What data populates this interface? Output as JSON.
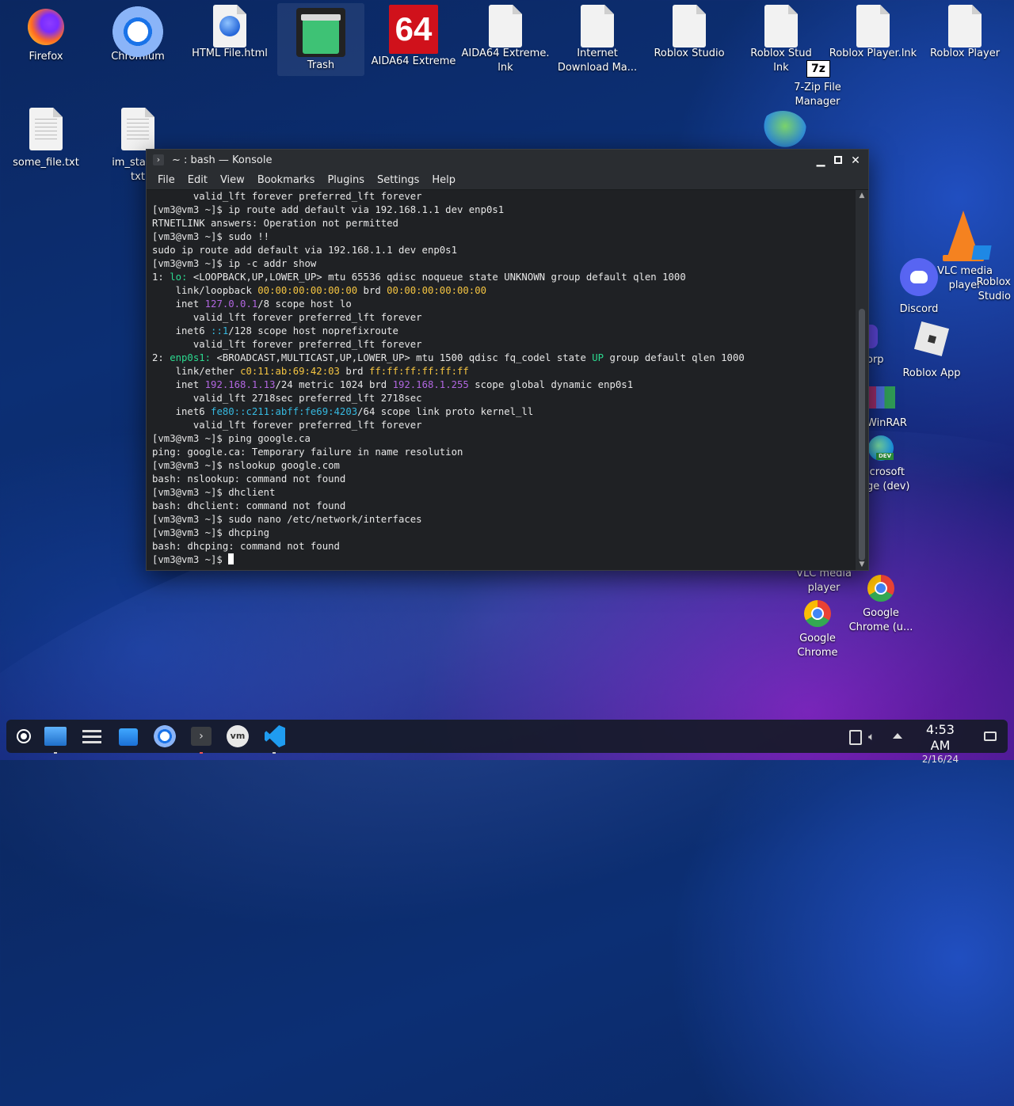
{
  "desktop": {
    "icons": [
      {
        "name": "firefox-icon",
        "label": "Firefox"
      },
      {
        "name": "chromium-icon",
        "label": "Chromium"
      },
      {
        "name": "html-file-icon",
        "label": "HTML File.html"
      },
      {
        "name": "trash-icon",
        "label": "Trash"
      },
      {
        "name": "aida64-icon",
        "label": "AIDA64 Extreme",
        "glyph": "64"
      },
      {
        "name": "aida64-lnk-icon",
        "label": "AIDA64 Extreme.\nlnk"
      },
      {
        "name": "internet-download-manager-icon",
        "label": "Internet\nDownload Ma..."
      },
      {
        "name": "roblox-studio-file-icon",
        "label": "Roblox Studio"
      },
      {
        "name": "roblox-studio-lnk-icon",
        "label": "Roblox Stud\nlnk"
      },
      {
        "name": "roblox-player-lnk-icon",
        "label": "Roblox Player.lnk"
      },
      {
        "name": "roblox-player-file-icon",
        "label": "Roblox Player"
      },
      {
        "name": "seven-zip-icon",
        "label": "7-Zip File\nManager",
        "glyph": "7z"
      },
      {
        "name": "some-file-icon",
        "label": "some_file.txt"
      },
      {
        "name": "im-stalkin-file-icon",
        "label": "im_stalkin\ntxt"
      },
      {
        "name": "vlc-icon",
        "label": "VLC media\nplayer"
      },
      {
        "name": "roblox-studio-icon",
        "label": "Roblox\nStudio"
      },
      {
        "name": "discord-icon",
        "label": "Discord"
      },
      {
        "name": "orp-icon",
        "label": "orp"
      },
      {
        "name": "roblox-app-icon",
        "label": "Roblox App"
      },
      {
        "name": "winrar-icon",
        "label": "WinRAR"
      },
      {
        "name": "edge-dev-icon",
        "label": "icrosoft\nge (dev)",
        "badge": "DEV"
      },
      {
        "name": "vlc-player-icon-2",
        "label": "VLC media\nplayer"
      },
      {
        "name": "google-chrome-icon",
        "label": "Google\nChrome"
      },
      {
        "name": "google-chrome-u-icon",
        "label": "Google\nChrome (u..."
      }
    ]
  },
  "konsole": {
    "title": "~ : bash — Konsole",
    "menu": [
      "File",
      "Edit",
      "View",
      "Bookmarks",
      "Plugins",
      "Settings",
      "Help"
    ],
    "lines": [
      [
        [
          "",
          "       valid_lft forever preferred_lft forever"
        ]
      ],
      [
        [
          "",
          "[vm3@vm3 ~]$ ip route add default via 192.168.1.1 dev enp0s1"
        ]
      ],
      [
        [
          "",
          "RTNETLINK answers: Operation not permitted"
        ]
      ],
      [
        [
          "",
          "[vm3@vm3 ~]$ sudo !!"
        ]
      ],
      [
        [
          "",
          "sudo ip route add default via 192.168.1.1 dev enp0s1"
        ]
      ],
      [
        [
          "",
          "[vm3@vm3 ~]$ ip -c addr show"
        ]
      ],
      [
        [
          "",
          "1: "
        ],
        [
          "g",
          "lo:"
        ],
        [
          "",
          " <LOOPBACK,UP,LOWER_UP> mtu 65536 qdisc noqueue state UNKNOWN group default qlen 1000"
        ]
      ],
      [
        [
          "",
          "    link/loopback "
        ],
        [
          "y",
          "00:00:00:00:00:00"
        ],
        [
          "",
          " brd "
        ],
        [
          "y",
          "00:00:00:00:00:00"
        ]
      ],
      [
        [
          "",
          "    inet "
        ],
        [
          "p",
          "127.0.0.1"
        ],
        [
          "",
          "/8 scope host lo"
        ]
      ],
      [
        [
          "",
          "       valid_lft forever preferred_lft forever"
        ]
      ],
      [
        [
          "",
          "    inet6 "
        ],
        [
          "c",
          "::1"
        ],
        [
          "",
          "/128 scope host noprefixroute"
        ]
      ],
      [
        [
          "",
          "       valid_lft forever preferred_lft forever"
        ]
      ],
      [
        [
          "",
          "2: "
        ],
        [
          "g",
          "enp0s1:"
        ],
        [
          "",
          " <BROADCAST,MULTICAST,UP,LOWER_UP> mtu 1500 qdisc fq_codel state "
        ],
        [
          "g",
          "UP"
        ],
        [
          "",
          " group default qlen 1000"
        ]
      ],
      [
        [
          "",
          "    link/ether "
        ],
        [
          "y",
          "c0:11:ab:69:42:03"
        ],
        [
          "",
          " brd "
        ],
        [
          "y",
          "ff:ff:ff:ff:ff:ff"
        ]
      ],
      [
        [
          "",
          "    inet "
        ],
        [
          "p",
          "192.168.1.13"
        ],
        [
          "",
          "/24 metric 1024 brd "
        ],
        [
          "p",
          "192.168.1.255"
        ],
        [
          "",
          " scope global dynamic enp0s1"
        ]
      ],
      [
        [
          "",
          "       valid_lft 2718sec preferred_lft 2718sec"
        ]
      ],
      [
        [
          "",
          "    inet6 "
        ],
        [
          "c",
          "fe80::c211:abff:fe69:4203"
        ],
        [
          "",
          "/64 scope link proto kernel_ll"
        ]
      ],
      [
        [
          "",
          "       valid_lft forever preferred_lft forever"
        ]
      ],
      [
        [
          "",
          "[vm3@vm3 ~]$ ping google.ca"
        ]
      ],
      [
        [
          "",
          "ping: google.ca: Temporary failure in name resolution"
        ]
      ],
      [
        [
          "",
          "[vm3@vm3 ~]$ nslookup google.com"
        ]
      ],
      [
        [
          "",
          "bash: nslookup: command not found"
        ]
      ],
      [
        [
          "",
          "[vm3@vm3 ~]$ dhclient"
        ]
      ],
      [
        [
          "",
          "bash: dhclient: command not found"
        ]
      ],
      [
        [
          "",
          "[vm3@vm3 ~]$ sudo nano /etc/network/interfaces"
        ]
      ],
      [
        [
          "",
          "[vm3@vm3 ~]$ dhcping"
        ]
      ],
      [
        [
          "",
          "bash: dhcping: command not found"
        ]
      ],
      [
        [
          "",
          "[vm3@vm3 ~]$ "
        ]
      ]
    ]
  },
  "taskbar": {
    "clock_time": "4:53 AM",
    "clock_date": "2/16/24"
  },
  "colors": {
    "term_green": "#2bd98f",
    "term_yellow": "#f5c542",
    "term_purple": "#b166e0",
    "term_cyan": "#36b9e0"
  }
}
